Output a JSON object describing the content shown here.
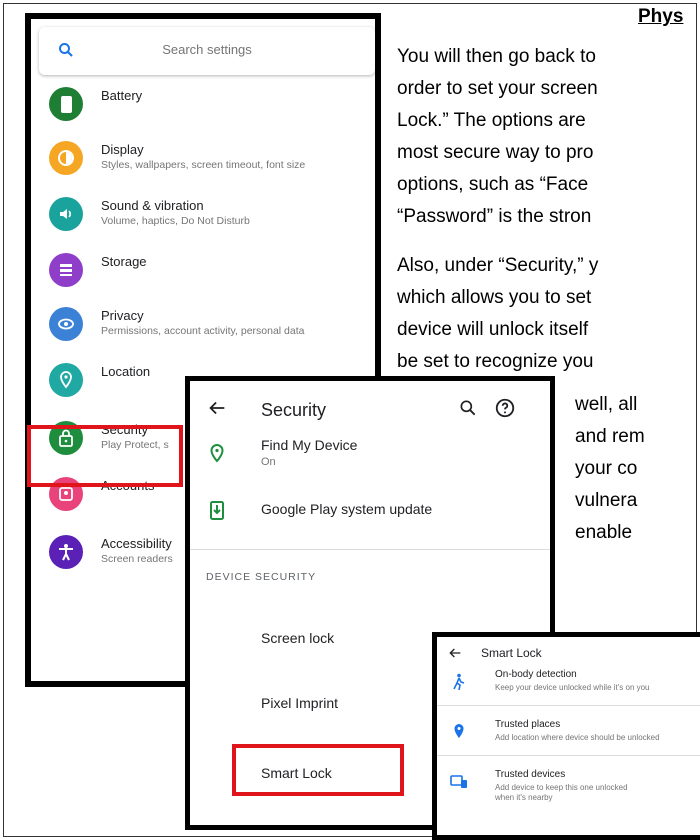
{
  "document": {
    "heading": "Phys",
    "lines": [
      "You will then go back to",
      "order to set your screen",
      "Lock.” The options are",
      "most secure way to pro",
      "options, such as “Face",
      "“Password” is the stron",
      "Also, under “Security,” y",
      "which allows you to set",
      "device will unlock itself",
      "be set to recognize you",
      "well, all",
      "and rem",
      "your co",
      "vulnera",
      "enable"
    ]
  },
  "settings": {
    "search_placeholder": "Search settings",
    "items": [
      {
        "title": "Battery",
        "subtitle": "",
        "icon": "battery-icon",
        "color": "#2e7d32"
      },
      {
        "title": "Display",
        "subtitle": "Styles, wallpapers, screen timeout, font size",
        "icon": "display-icon",
        "color": "#f5a623"
      },
      {
        "title": "Sound & vibration",
        "subtitle": "Volume, haptics, Do Not Disturb",
        "icon": "sound-icon",
        "color": "#1aa39c"
      },
      {
        "title": "Storage",
        "subtitle": "",
        "icon": "storage-icon",
        "color": "#8e3ec9"
      },
      {
        "title": "Privacy",
        "subtitle": "Permissions, account activity, personal data",
        "icon": "privacy-icon",
        "color": "#3b82d6"
      },
      {
        "title": "Location",
        "subtitle": "",
        "icon": "location-icon",
        "color": "#20a8a3"
      },
      {
        "title": "Security",
        "subtitle": "Play Protect, s",
        "icon": "lock-icon",
        "color": "#1e8e3e"
      },
      {
        "title": "Accounts",
        "subtitle": "",
        "icon": "accounts-icon",
        "color": "#e8437a"
      },
      {
        "title": "Accessibility",
        "subtitle": "Screen readers",
        "icon": "accessibility-icon",
        "color": "#5b21b6"
      }
    ]
  },
  "security": {
    "title": "Security",
    "find_my_device": {
      "title": "Find My Device",
      "subtitle": "On"
    },
    "play_update": {
      "title": "Google Play system update"
    },
    "section_label": "DEVICE SECURITY",
    "screen_lock": "Screen lock",
    "pixel_imprint": "Pixel Imprint",
    "smart_lock": "Smart Lock"
  },
  "smart_lock": {
    "title": "Smart Lock",
    "items": [
      {
        "title": "On-body detection",
        "subtitle": "Keep your device unlocked while it's on you"
      },
      {
        "title": "Trusted places",
        "subtitle": "Add location where device should be unlocked"
      },
      {
        "title": "Trusted devices",
        "subtitle": "Add device to keep this one unlocked when it's nearby"
      }
    ]
  },
  "colors": {
    "highlight": "#e0151b",
    "accent_green": "#1e8e3e",
    "accent_blue": "#1a73e8"
  }
}
